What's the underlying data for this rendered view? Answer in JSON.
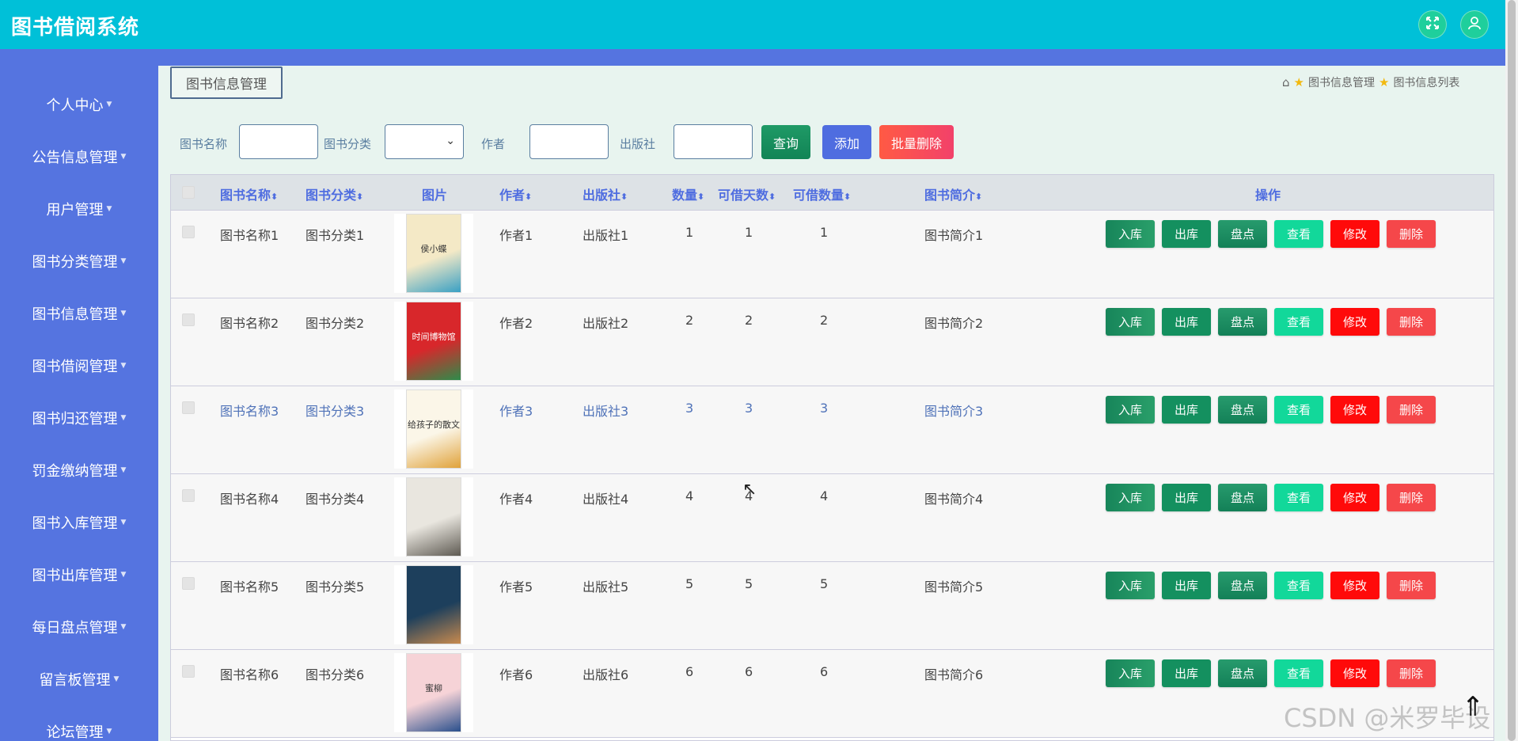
{
  "app": {
    "title": "图书借阅系统"
  },
  "header": {
    "fullscreen_icon": "expand-icon",
    "user_icon": "user-icon"
  },
  "sidebar": {
    "items": [
      {
        "label": "个人中心"
      },
      {
        "label": "公告信息管理"
      },
      {
        "label": "用户管理"
      },
      {
        "label": "图书分类管理"
      },
      {
        "label": "图书信息管理"
      },
      {
        "label": "图书借阅管理"
      },
      {
        "label": "图书归还管理"
      },
      {
        "label": "罚金缴纳管理"
      },
      {
        "label": "图书入库管理"
      },
      {
        "label": "图书出库管理"
      },
      {
        "label": "每日盘点管理"
      },
      {
        "label": "留言板管理"
      },
      {
        "label": "论坛管理"
      }
    ]
  },
  "tab": {
    "label": "图书信息管理"
  },
  "breadcrumb": {
    "level1": "图书信息管理",
    "level2": "图书信息列表"
  },
  "search": {
    "name_label": "图书名称",
    "name_value": "",
    "category_label": "图书分类",
    "category_value": "",
    "author_label": "作者",
    "author_value": "",
    "publisher_label": "出版社",
    "publisher_value": "",
    "query_label": "查询",
    "add_label": "添加",
    "batch_delete_label": "批量删除"
  },
  "table": {
    "headers": {
      "name": "图书名称",
      "category": "图书分类",
      "image": "图片",
      "author": "作者",
      "publisher": "出版社",
      "quantity": "数量",
      "borrow_days": "可借天数",
      "borrow_count": "可借数量",
      "intro": "图书简介",
      "actions": "操作"
    },
    "action_labels": {
      "stock_in": "入库",
      "stock_out": "出库",
      "inventory": "盘点",
      "view": "查看",
      "edit": "修改",
      "delete": "删除"
    },
    "rows": [
      {
        "name": "图书名称1",
        "category": "图书分类1",
        "author": "作者1",
        "publisher": "出版社1",
        "quantity": "1",
        "borrow_days": "1",
        "borrow_count": "1",
        "intro": "图书简介1",
        "cover_title": "侯小蝶",
        "cover_color": "#f4e9c6",
        "cover_accent": "#3aa0c4"
      },
      {
        "name": "图书名称2",
        "category": "图书分类2",
        "author": "作者2",
        "publisher": "出版社2",
        "quantity": "2",
        "borrow_days": "2",
        "borrow_count": "2",
        "intro": "图书简介2",
        "cover_title": "时间博物馆",
        "cover_color": "#d8272b",
        "cover_accent": "#2d8c4a"
      },
      {
        "name": "图书名称3",
        "category": "图书分类3",
        "author": "作者3",
        "publisher": "出版社3",
        "quantity": "3",
        "borrow_days": "3",
        "borrow_count": "3",
        "intro": "图书简介3",
        "cover_title": "给孩子的散文",
        "cover_color": "#fbf6e8",
        "cover_accent": "#e0a23a"
      },
      {
        "name": "图书名称4",
        "category": "图书分类4",
        "author": "作者4",
        "publisher": "出版社4",
        "quantity": "4",
        "borrow_days": "4",
        "borrow_count": "4",
        "intro": "图书简介4",
        "cover_title": "",
        "cover_color": "#e9e6df",
        "cover_accent": "#5e5a52"
      },
      {
        "name": "图书名称5",
        "category": "图书分类5",
        "author": "作者5",
        "publisher": "出版社5",
        "quantity": "5",
        "borrow_days": "5",
        "borrow_count": "5",
        "intro": "图书简介5",
        "cover_title": "",
        "cover_color": "#1d3f5c",
        "cover_accent": "#c88a4e"
      },
      {
        "name": "图书名称6",
        "category": "图书分类6",
        "author": "作者6",
        "publisher": "出版社6",
        "quantity": "6",
        "borrow_days": "6",
        "borrow_count": "6",
        "intro": "图书简介6",
        "cover_title": "蜜柳",
        "cover_color": "#f6d3d7",
        "cover_accent": "#2a4f8c"
      }
    ]
  },
  "watermark": "CSDN @米罗毕设"
}
